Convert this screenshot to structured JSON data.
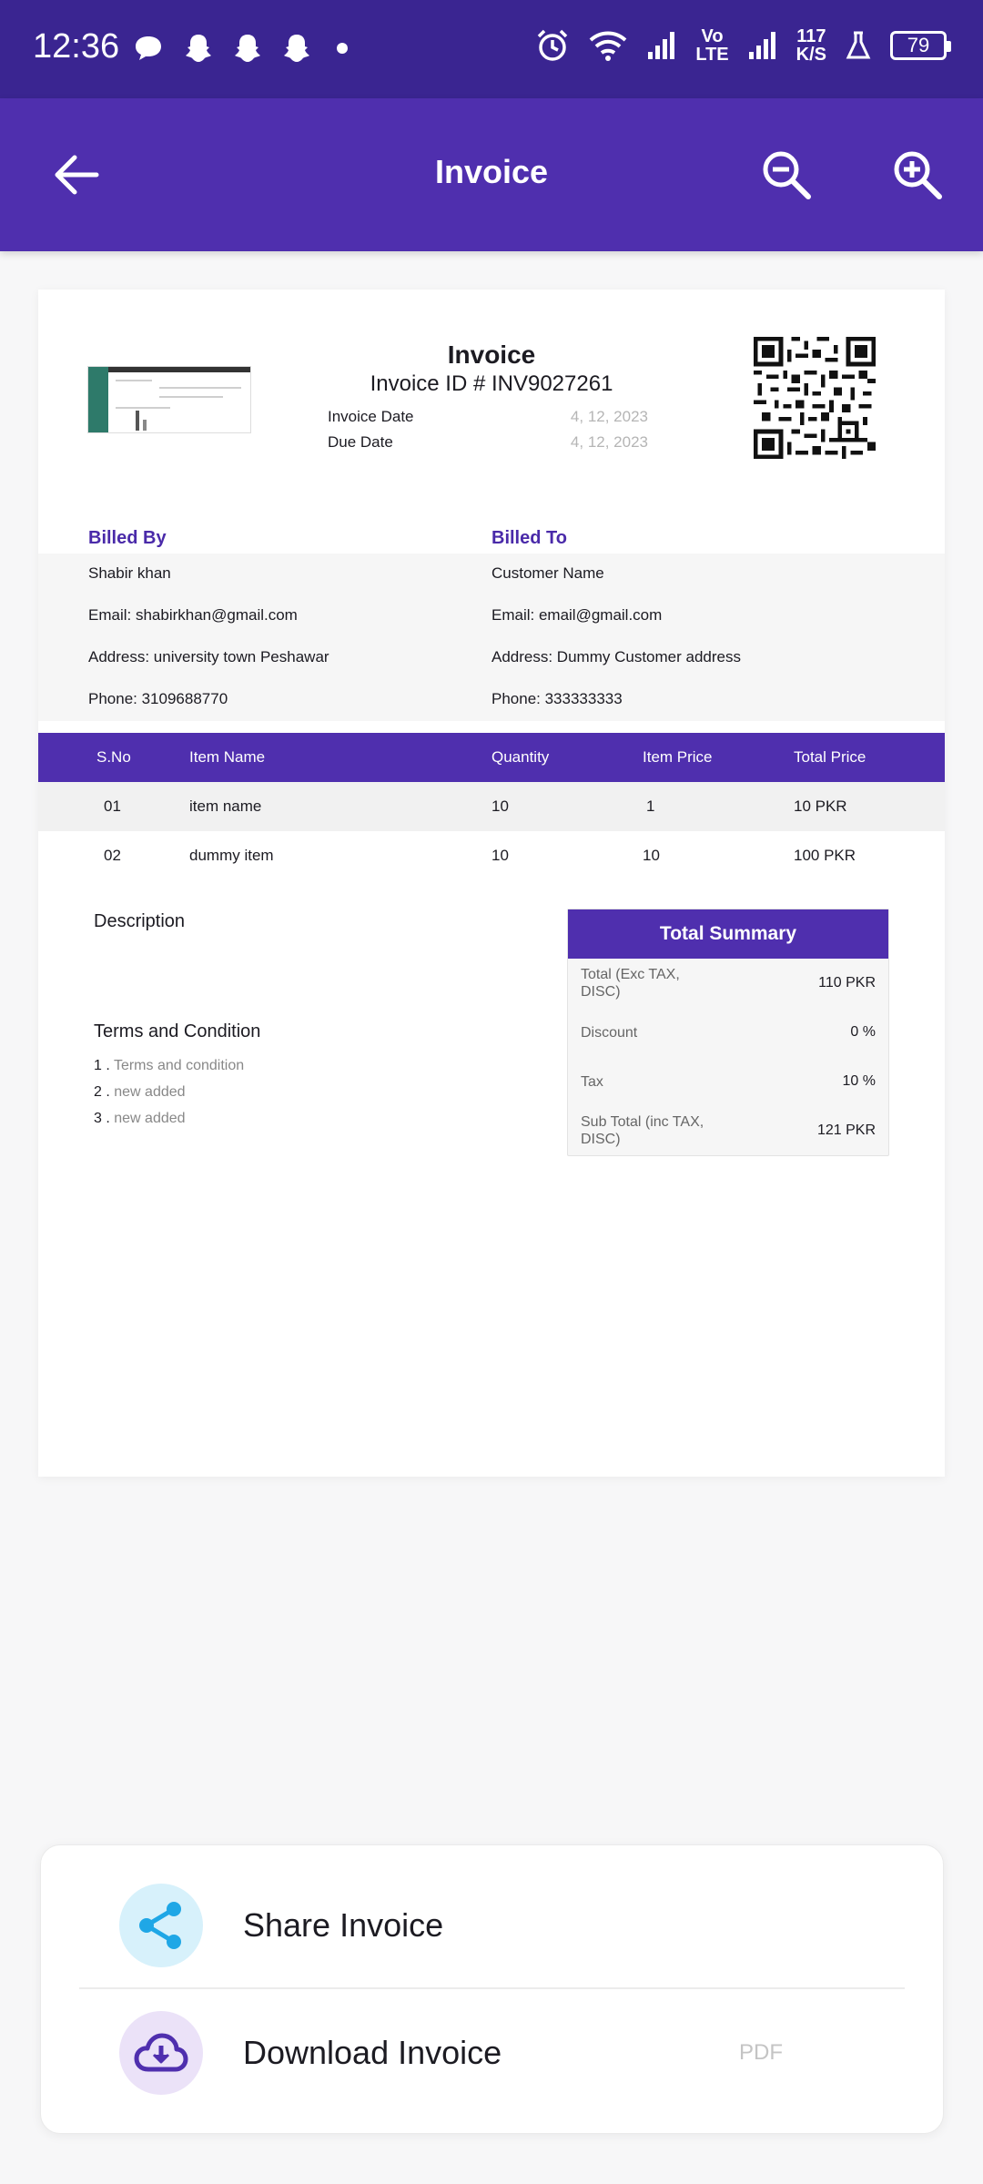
{
  "status_bar": {
    "time": "12:36",
    "network_label_top": "Vo",
    "network_label_bottom": "LTE",
    "speed_value": "117",
    "speed_unit": "K/S",
    "battery": "79"
  },
  "app_bar": {
    "title": "Invoice"
  },
  "invoice": {
    "heading": "Invoice",
    "id_line": "Invoice ID #  INV9027261",
    "invoice_date_label": "Invoice Date",
    "invoice_date_value": "4, 12, 2023",
    "due_date_label": "Due Date",
    "due_date_value": "4, 12, 2023"
  },
  "billed_by": {
    "header": "Billed By",
    "name": "Shabir khan",
    "email": "Email: shabirkhan@gmail.com",
    "address": "Address: university town Peshawar",
    "phone": "Phone: 3109688770"
  },
  "billed_to": {
    "header": "Billed To",
    "name": "Customer Name",
    "email": "Email: email@gmail.com",
    "address": "Address: Dummy Customer address",
    "phone": "Phone: 333333333"
  },
  "items_table": {
    "headers": [
      "S.No",
      "Item Name",
      "Quantity",
      "Item Price",
      "Total Price"
    ],
    "rows": [
      [
        "01",
        "item name",
        "10",
        "1",
        "10 PKR"
      ],
      [
        "02",
        "dummy item",
        "10",
        "10",
        "100 PKR"
      ]
    ]
  },
  "description_label": "Description",
  "terms": {
    "title": "Terms and Condition",
    "items": [
      {
        "num": "1 .",
        "text": "Terms and condition"
      },
      {
        "num": "2 .",
        "text": "new added"
      },
      {
        "num": "3 .",
        "text": "new added"
      }
    ]
  },
  "summary": {
    "title": "Total Summary",
    "rows": [
      {
        "label": "Total (Exc TAX, DISC)",
        "value": "110  PKR"
      },
      {
        "label": "Discount",
        "value": "0 %"
      },
      {
        "label": "Tax",
        "value": "10 %"
      },
      {
        "label": "Sub Total (inc TAX, DISC)",
        "value": "121  PKR"
      }
    ]
  },
  "actions": {
    "share_label": "Share Invoice",
    "download_label": "Download Invoice",
    "download_tag": "PDF"
  },
  "colors": {
    "status_bar": "#3a2591",
    "primary": "#4f2fae",
    "share_bg": "#d7f1fb",
    "share_icon": "#1fa7e6",
    "download_bg": "#ebe2f8",
    "download_icon": "#4f2fae"
  }
}
